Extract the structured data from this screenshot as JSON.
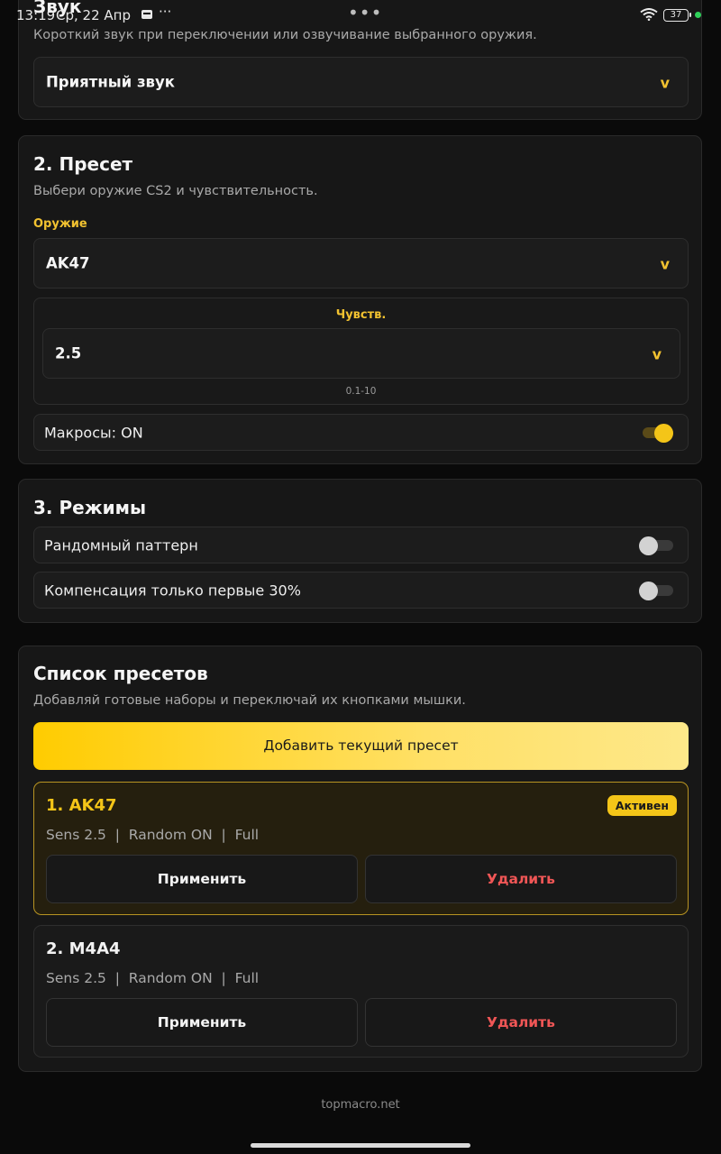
{
  "status_bar": {
    "time": "13:19",
    "date": "Ср, 22 Апр",
    "dots": "···",
    "center_dots": "•••",
    "battery": "37"
  },
  "sound_section": {
    "title": "Звук",
    "description": "Короткий звук при переключении или озвучивание выбранного оружия.",
    "selected": "Приятный звук",
    "chevron": "v"
  },
  "preset_section": {
    "title": "2. Пресет",
    "description": "Выбери оружие CS2 и чувствительность.",
    "weapon_label": "Оружие",
    "weapon_value": "AK47",
    "sens_label": "Чувств.",
    "sens_value": "2.5",
    "sens_range": "0.1-10",
    "macros_label": "Макросы: ON",
    "macros_on": true,
    "chevron": "v"
  },
  "modes_section": {
    "title": "3. Режимы",
    "modes": [
      {
        "label": "Рандомный паттерн",
        "on": false
      },
      {
        "label": "Компенсация только первые 30%",
        "on": false
      }
    ]
  },
  "presets_list": {
    "title": "Список пресетов",
    "description": "Добавляй готовые наборы и переключай их кнопками мышки.",
    "add_button": "Добавить текущий пресет",
    "items": [
      {
        "name": "1. AK47",
        "info": "Sens 2.5  |  Random ON  |  Full",
        "badge": "Активен",
        "apply": "Применить",
        "delete": "Удалить"
      },
      {
        "name": "2. M4A4",
        "info": "Sens 2.5  |  Random ON  |  Full",
        "apply": "Применить",
        "delete": "Удалить"
      }
    ]
  },
  "footer": "topmacro.net",
  "colors": {
    "accent": "#f4c518",
    "danger": "#f05656",
    "background": "#0a0a0a",
    "card": "#171717"
  }
}
